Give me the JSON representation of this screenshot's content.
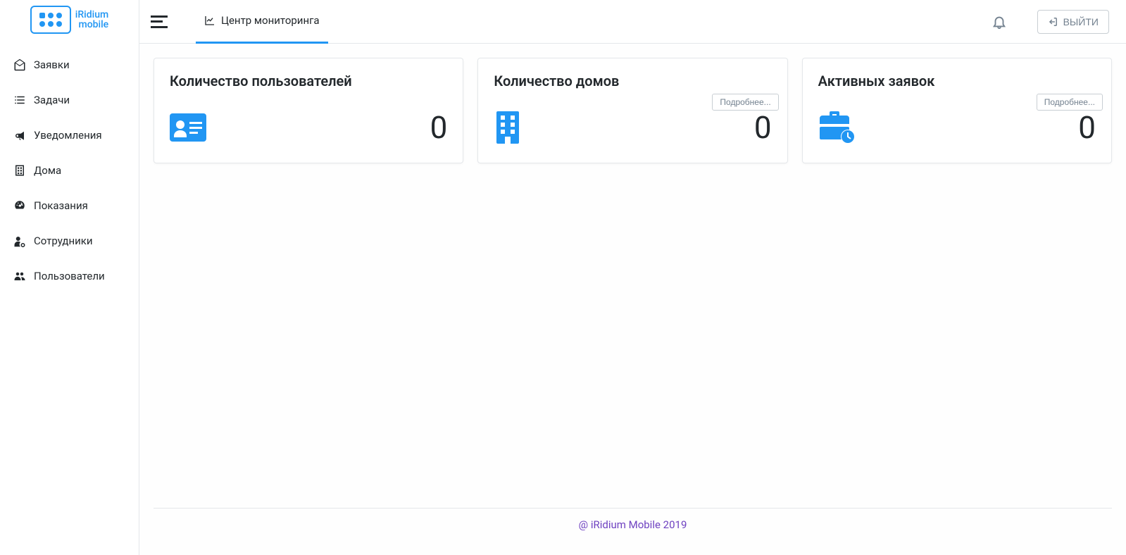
{
  "brand": {
    "line1": "iRidium",
    "line2": "mobile"
  },
  "sidebar": {
    "items": [
      {
        "label": "Заявки"
      },
      {
        "label": "Задачи"
      },
      {
        "label": "Уведомления"
      },
      {
        "label": "Дома"
      },
      {
        "label": "Показания"
      },
      {
        "label": "Сотрудники"
      },
      {
        "label": "Пользователи"
      }
    ]
  },
  "tab": {
    "label": "Центр мониторинга"
  },
  "logout": "ВЫЙТИ",
  "cards": [
    {
      "title": "Количество пользователей",
      "value": "0",
      "more": null
    },
    {
      "title": "Количество домов",
      "value": "0",
      "more": "Подробнее..."
    },
    {
      "title": "Активных заявок",
      "value": "0",
      "more": "Подробнее..."
    }
  ],
  "footer": "@ iRidium Mobile 2019"
}
